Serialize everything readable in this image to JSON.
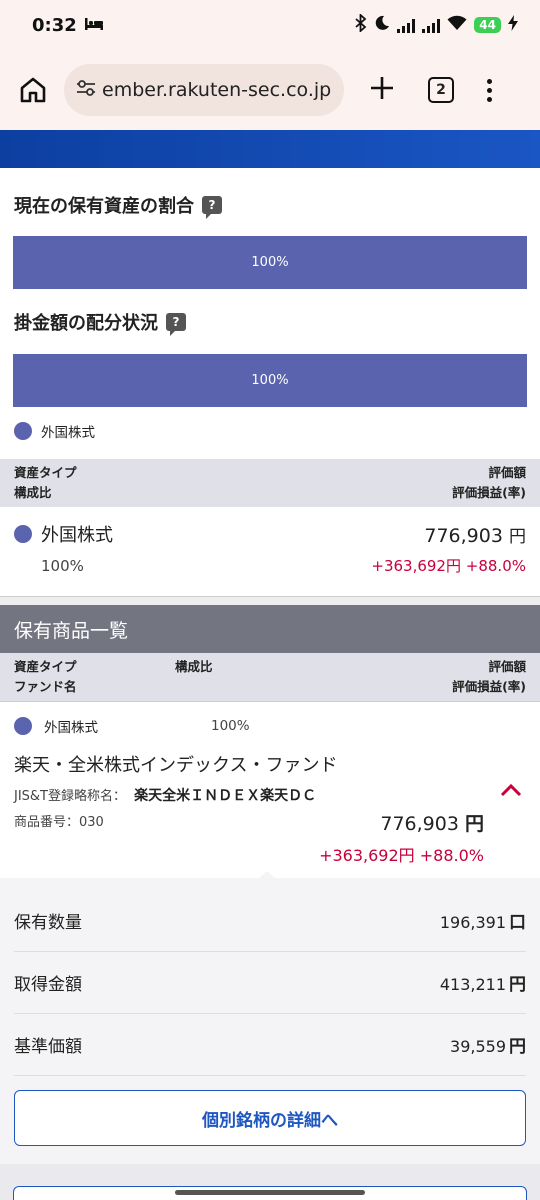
{
  "status_bar": {
    "time": "0:32",
    "battery": "44"
  },
  "browser": {
    "url": "ember.rakuten-sec.co.jp",
    "tab_count": "2"
  },
  "allocation": {
    "current_title": "現在の保有資産の割合",
    "current_bar": "100%",
    "contribution_title": "掛金額の配分状況",
    "contribution_bar": "100%",
    "legend_label": "外国株式"
  },
  "asset_table": {
    "header_left_1": "資産タイプ",
    "header_left_2": "構成比",
    "header_right_1": "評価額",
    "header_right_2": "評価損益(率)",
    "row": {
      "type": "外国株式",
      "ratio": "100%",
      "value": "776,903",
      "value_unit": "円",
      "gain": "+363,692円",
      "gain_rate": "+88.0%"
    }
  },
  "holdings": {
    "title": "保有商品一覧",
    "header_left_1": "資産タイプ",
    "header_mid_1": "構成比",
    "header_left_2": "ファンド名",
    "header_right_1": "評価額",
    "header_right_2": "評価損益(率)",
    "item": {
      "type": "外国株式",
      "ratio": "100%",
      "fund_name": "楽天・全米株式インデックス・ファンド",
      "jis_label": "JIS&T登録略称名：",
      "jis_name": "楽天全米ＩＮＤＥＸ楽天ＤＣ",
      "product_no": "商品番号：030",
      "value": "776,903",
      "value_unit": "円",
      "gain": "+363,692円",
      "gain_rate": "+88.0%"
    },
    "details": [
      {
        "label": "保有数量",
        "value": "196,391",
        "unit": "口"
      },
      {
        "label": "取得金額",
        "value": "413,211",
        "unit": "円"
      },
      {
        "label": "基準価額",
        "value": "39,559",
        "unit": "円"
      }
    ],
    "detail_button": "個別銘柄の詳細へ"
  },
  "colors": {
    "accent_blue": "#1f57c2",
    "bar_color": "#5a63ad",
    "gain_red": "#c8003c"
  }
}
